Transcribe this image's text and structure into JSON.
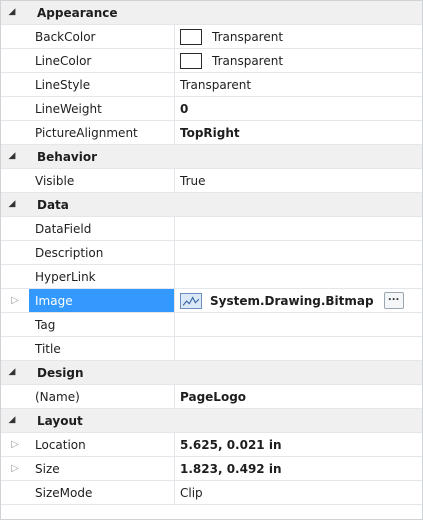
{
  "property_grid": {
    "categories": [
      {
        "label": "Appearance",
        "properties": [
          {
            "name": "BackColor",
            "value": "Transparent",
            "swatch": "#ffffff"
          },
          {
            "name": "LineColor",
            "value": "Transparent",
            "swatch": "#ffffff"
          },
          {
            "name": "LineStyle",
            "value": "Transparent"
          },
          {
            "name": "LineWeight",
            "value": "0"
          },
          {
            "name": "PictureAlignment",
            "value": "TopRight"
          }
        ]
      },
      {
        "label": "Behavior",
        "properties": [
          {
            "name": "Visible",
            "value": "True"
          }
        ]
      },
      {
        "label": "Data",
        "properties": [
          {
            "name": "DataField",
            "value": ""
          },
          {
            "name": "Description",
            "value": ""
          },
          {
            "name": "HyperLink",
            "value": ""
          },
          {
            "name": "Image",
            "value": "System.Drawing.Bitmap",
            "ellipsis": "..."
          },
          {
            "name": "Tag",
            "value": ""
          },
          {
            "name": "Title",
            "value": ""
          }
        ]
      },
      {
        "label": "Design",
        "properties": [
          {
            "name": "(Name)",
            "value": "PageLogo"
          }
        ]
      },
      {
        "label": "Layout",
        "properties": [
          {
            "name": "Location",
            "value": "5.625, 0.021 in"
          },
          {
            "name": "Size",
            "value": "1.823, 0.492 in"
          },
          {
            "name": "SizeMode",
            "value": "Clip"
          }
        ]
      }
    ]
  },
  "colors": {
    "selection": "#3399ff",
    "category_bg": "#f0f0f0"
  }
}
